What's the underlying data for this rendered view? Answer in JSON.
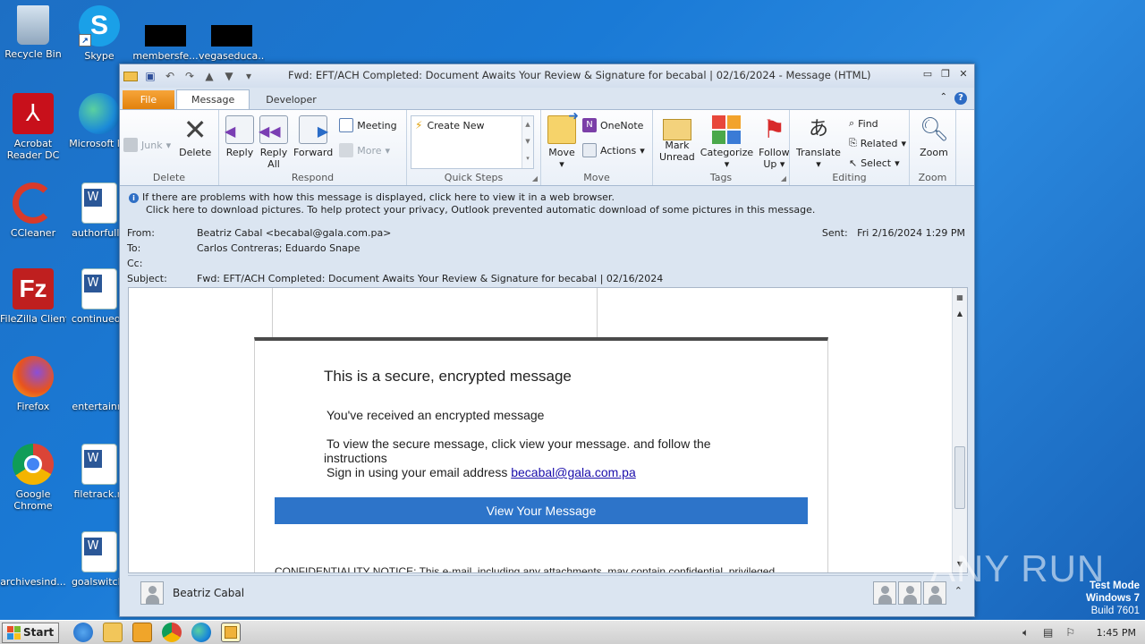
{
  "desktop": {
    "icons": [
      {
        "label": "Recycle Bin"
      },
      {
        "label": "Skype"
      },
      {
        "label": "membersfe..."
      },
      {
        "label": "vegaseduca..."
      },
      {
        "label": "Acrobat Reader DC"
      },
      {
        "label": "Microsoft Ed"
      },
      {
        "label": "CCleaner"
      },
      {
        "label": "authorfully."
      },
      {
        "label": "FileZilla Client"
      },
      {
        "label": "continueoff"
      },
      {
        "label": "Firefox"
      },
      {
        "label": "entertainm"
      },
      {
        "label": "Google Chrome"
      },
      {
        "label": "filetrack.rt"
      },
      {
        "label": "archivesind..."
      },
      {
        "label": "goalswitch."
      }
    ]
  },
  "window": {
    "title": "Fwd: EFT/ACH Completed: Document Awaits Your Review & Signature for becabal | 02/16/2024  -  Message (HTML)",
    "tabs": [
      "File",
      "Message",
      "Developer"
    ],
    "ribbon": {
      "delete": {
        "junk": "Junk",
        "delete": "Delete",
        "group": "Delete"
      },
      "respond": {
        "reply": "Reply",
        "reply_all_1": "Reply",
        "reply_all_2": "All",
        "forward": "Forward",
        "meeting": "Meeting",
        "more": "More",
        "group": "Respond"
      },
      "quick_steps": {
        "create_new": "Create New",
        "group": "Quick Steps"
      },
      "move": {
        "move": "Move",
        "onenote": "OneNote",
        "actions": "Actions",
        "group": "Move"
      },
      "tags": {
        "mark_unread_1": "Mark",
        "mark_unread_2": "Unread",
        "categorize": "Categorize",
        "follow_up_1": "Follow",
        "follow_up_2": "Up",
        "group": "Tags"
      },
      "editing": {
        "translate": "Translate",
        "find": "Find",
        "related": "Related",
        "select": "Select",
        "group": "Editing"
      },
      "zoom": {
        "zoom": "Zoom",
        "group": "Zoom"
      }
    },
    "infobar": {
      "line1": "If there are problems with how this message is displayed, click here to view it in a web browser.",
      "line2": "Click here to download pictures. To help protect your privacy, Outlook prevented automatic download of some pictures in this message."
    },
    "headers": {
      "from_label": "From:",
      "from_value": "Beatriz Cabal <becabal@gala.com.pa>",
      "to_label": "To:",
      "to_value": "Carlos Contreras; Eduardo Snape",
      "cc_label": "Cc:",
      "cc_value": "",
      "subject_label": "Subject:",
      "subject_value": "Fwd: EFT/ACH Completed: Document Awaits Your Review & Signature for becabal | 02/16/2024",
      "sent_label": "Sent:",
      "sent_value": "Fri 2/16/2024 1:29 PM"
    },
    "message": {
      "title": "This is a secure, encrypted message",
      "p1": "You've received an encrypted message",
      "p2a": "To view the secure message, click view your message. and follow the",
      "p2b": "instructions",
      "p3_prefix": "Sign in using your email address ",
      "p3_link": "becabal@gala.com.pa",
      "button": "View Your Message",
      "confidentiality": "CONFIDENTIALITY NOTICE: This e-mail, including any attachments, may contain confidential, privileged"
    },
    "people_pane": {
      "name": "Beatriz Cabal"
    }
  },
  "taskbar": {
    "start": "Start",
    "clock": "1:45 PM"
  },
  "watermark": {
    "line1": "Test Mode",
    "line2": "Windows 7",
    "line3": "Build 7601",
    "anyrun": "ANY RUN"
  },
  "colors": {
    "desktop": "#1a7ad6",
    "file_tab": "#e2810c",
    "view_button": "#2d74c9",
    "link": "#1a0dab"
  }
}
